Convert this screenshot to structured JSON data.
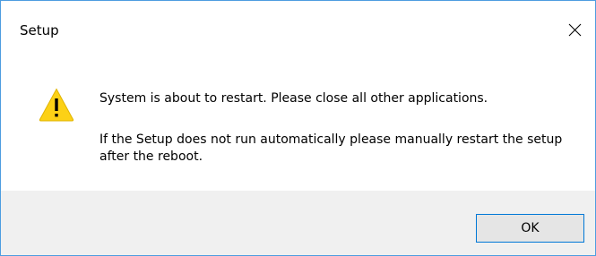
{
  "window": {
    "title": "Setup"
  },
  "message": {
    "primary": "System is about to restart. Please close all other applications.",
    "secondary": "If the Setup does not run automatically please manually restart the setup after the reboot."
  },
  "buttons": {
    "ok_label": "OK"
  },
  "icons": {
    "close": "close-icon",
    "warning": "warning-icon"
  },
  "colors": {
    "window_border": "#4d9de0",
    "footer_bg": "#f0f0f0",
    "button_border": "#0078d7",
    "warning_fill": "#fcd116"
  }
}
